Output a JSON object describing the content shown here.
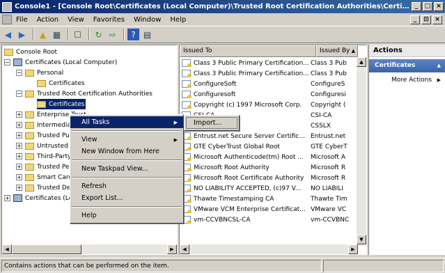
{
  "window": {
    "title": "Console1 - [Console Root\\Certificates (Local Computer)\\Trusted Root Certification Authorities\\Certifi...",
    "min": "_",
    "max": "□",
    "close": "×"
  },
  "menubar": {
    "items": [
      "File",
      "Action",
      "View",
      "Favorites",
      "Window",
      "Help"
    ],
    "mdi": [
      "_",
      "⊡",
      "×"
    ]
  },
  "tree": {
    "root": "Console Root",
    "nodes": [
      {
        "label": "Certificates (Local Computer)",
        "exp": "−"
      },
      {
        "label": "Personal",
        "exp": "−"
      },
      {
        "label": "Certificates",
        "exp": ""
      },
      {
        "label": "Trusted Root Certification Authorities",
        "exp": "−"
      },
      {
        "label": "Certificates",
        "exp": ""
      },
      {
        "label": "Enterprise Trust",
        "exp": "+"
      },
      {
        "label": "Intermediate Certification Authorities",
        "exp": "+"
      },
      {
        "label": "Trusted Publishers",
        "exp": "+"
      },
      {
        "label": "Untrusted Certificates",
        "exp": "+"
      },
      {
        "label": "Third-Party Root Certification Authorities",
        "exp": "+"
      },
      {
        "label": "Trusted People",
        "exp": "+"
      },
      {
        "label": "Smart Card Trusted Roots",
        "exp": "+"
      },
      {
        "label": "Trusted Devices",
        "exp": "+"
      },
      {
        "label": "Certificates (Local Computer)",
        "exp": "+"
      }
    ]
  },
  "list": {
    "columns": [
      "Issued To",
      "Issued By"
    ],
    "sort_arrow": "▲",
    "rows": [
      {
        "to": "Class 3 Public Primary Certification...",
        "by": "Class 3 Pub"
      },
      {
        "to": "Class 3 Public Primary Certification...",
        "by": "Class 3 Pub"
      },
      {
        "to": "ConfigureSoft",
        "by": "ConfigureS"
      },
      {
        "to": "Configuresoft",
        "by": "Configuresi"
      },
      {
        "to": "Copyright (c) 1997 Microsoft Corp.",
        "by": "Copyright ("
      },
      {
        "to": "CSI-CA",
        "by": "CSI-CA"
      },
      {
        "to": "CSSLX",
        "by": "CSSLX"
      },
      {
        "to": "Entrust.net Secure Server Certific...",
        "by": "Entrust.net"
      },
      {
        "to": "GTE CyberTrust Global Root",
        "by": "GTE CyberT"
      },
      {
        "to": "Microsoft Authenticode(tm) Root ...",
        "by": "Microsoft A"
      },
      {
        "to": "Microsoft Root Authority",
        "by": "Microsoft R"
      },
      {
        "to": "Microsoft Root Certificate Authority",
        "by": "Microsoft R"
      },
      {
        "to": "NO LIABILITY ACCEPTED, (c)97 V...",
        "by": "NO LIABILI"
      },
      {
        "to": "Thawte Timestamping CA",
        "by": "Thawte Tim"
      },
      {
        "to": "VMware VCM Enterprise Certificat...",
        "by": "VMware VC"
      },
      {
        "to": "vm-CCVBNCSL-CA",
        "by": "vm-CCVBNC"
      }
    ]
  },
  "actions": {
    "title": "Actions",
    "section": "Certificates",
    "section_arrow": "▲",
    "more": "More Actions",
    "more_arrow": "▶"
  },
  "context_menu": {
    "items": [
      {
        "label": "All Tasks",
        "arrow": "▶"
      },
      {
        "label": "View",
        "arrow": "▶"
      },
      {
        "label": "New Window from Here",
        "arrow": ""
      },
      {
        "label": "New Taskpad View...",
        "arrow": ""
      },
      {
        "label": "Refresh",
        "arrow": ""
      },
      {
        "label": "Export List...",
        "arrow": ""
      },
      {
        "label": "Help",
        "arrow": ""
      }
    ]
  },
  "submenu": {
    "items": [
      "Import..."
    ]
  },
  "status": {
    "text": "Contains actions that can be performed on the item."
  }
}
